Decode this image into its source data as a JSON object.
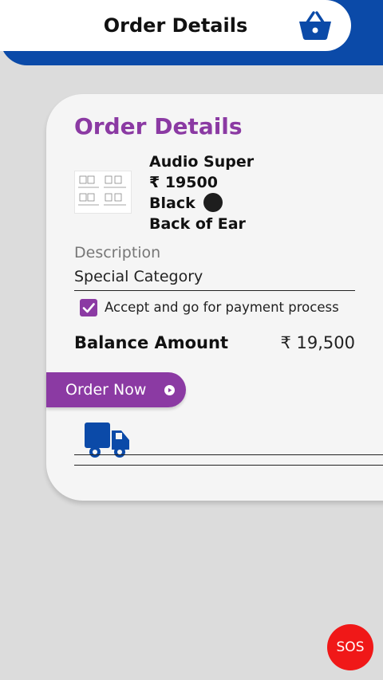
{
  "header": {
    "title": "Order Details",
    "cart_icon": "basket-icon",
    "colors": {
      "bar": "#0b4aa8",
      "background": "#ffffff"
    }
  },
  "order": {
    "title": "Order Details",
    "product": {
      "name": "Audio Super",
      "price": "₹ 19500",
      "color_name": "Black",
      "color_swatch": "#1e1e1e",
      "style": "Back of Ear"
    },
    "description": {
      "label": "Description",
      "value": "Special Category"
    },
    "accept": {
      "checked": true,
      "label": "Accept and go for payment process"
    },
    "balance": {
      "label": "Balance Amount",
      "value": "₹ 19,500"
    },
    "order_button": {
      "label": "Order Now",
      "icon": "play-circle-icon"
    },
    "delivery_icon": "truck-icon"
  },
  "sos": {
    "label": "SOS",
    "color": "#f01818"
  },
  "theme": {
    "accent": "#8b3aa3",
    "primary": "#0b4aa8"
  }
}
